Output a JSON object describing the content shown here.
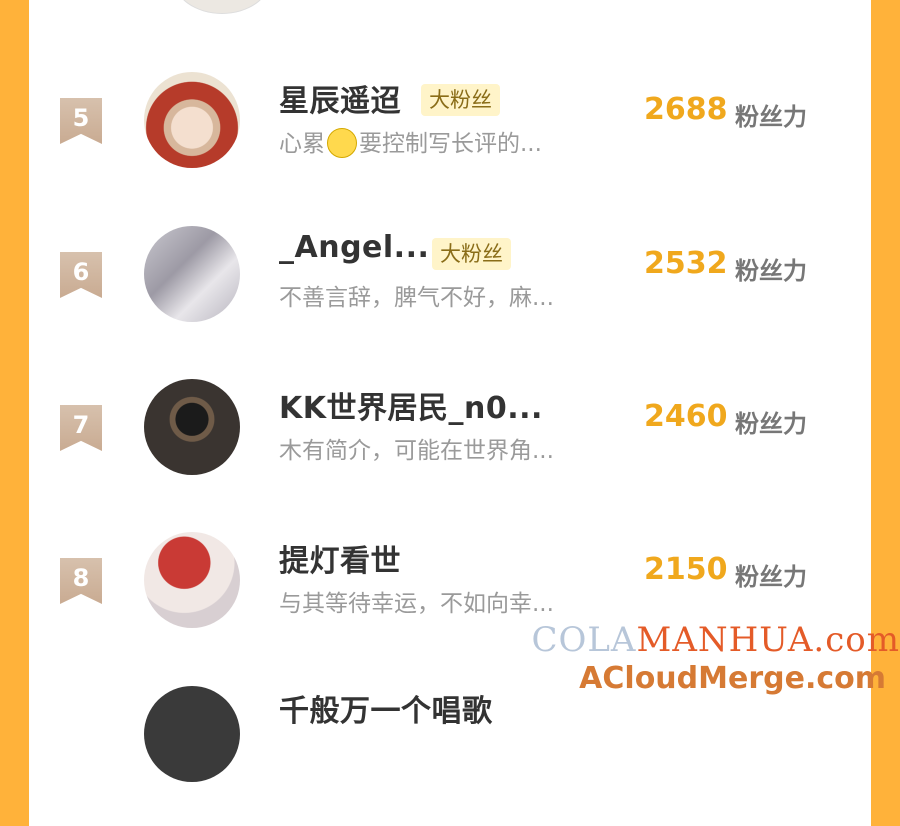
{
  "rows": [
    {
      "rank": "5",
      "name": "星辰遥迢",
      "badge": "大粉丝",
      "bio_before": "心累",
      "bio_after": "要控制写长评的...",
      "score": "2688",
      "unit": "粉丝力"
    },
    {
      "rank": "6",
      "name": "_Angel...",
      "badge": "大粉丝",
      "bio": "不善言辞，脾气不好，麻...",
      "score": "2532",
      "unit": "粉丝力"
    },
    {
      "rank": "7",
      "name": "KK世界居民_n0...",
      "bio": "木有简介，可能在世界角...",
      "score": "2460",
      "unit": "粉丝力"
    },
    {
      "rank": "8",
      "name": "提灯看世",
      "bio": "与其等待幸运，不如向幸...",
      "score": "2150",
      "unit": "粉丝力"
    },
    {
      "name": "千般万一个唱歌"
    }
  ],
  "watermark": {
    "line1_a": "COLA",
    "line1_b": "MANHUA.com",
    "line2": "ACloudMerge.com"
  }
}
